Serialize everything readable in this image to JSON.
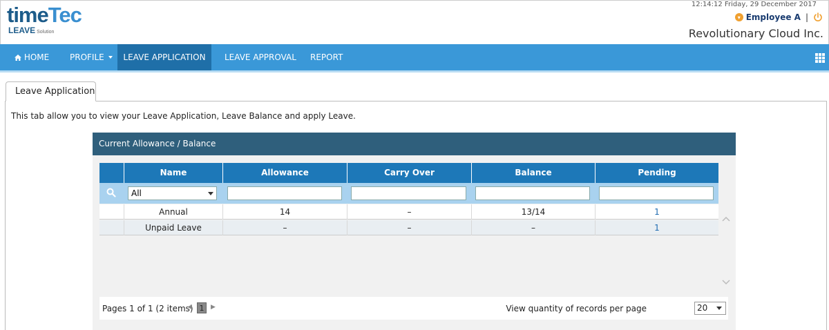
{
  "header": {
    "logo_top": "time",
    "logo_top_accent": "Tec",
    "logo_sub": "LEAVE",
    "logo_sub_small": "Solution",
    "datetime": "12:14:12 Friday, 29 December 2017",
    "user_name": "Employee A",
    "separator": "|",
    "company": "Revolutionary Cloud Inc."
  },
  "nav": {
    "home": "HOME",
    "profile": "PROFILE",
    "leave_application": "LEAVE APPLICATION",
    "leave_approval": "LEAVE APPROVAL",
    "report": "REPORT",
    "active": "leave_application",
    "home_icon": "home-icon",
    "apps_icon": "apps-grid-icon"
  },
  "tab": {
    "label": "Leave Application"
  },
  "description": "This tab allow you to view your Leave Application, Leave Balance and apply Leave.",
  "widget": {
    "title": "Current Allowance / Balance",
    "columns": [
      "Name",
      "Allowance",
      "Carry Over",
      "Balance",
      "Pending"
    ],
    "filter": {
      "name_selected": "All"
    },
    "rows": [
      {
        "name": "Annual",
        "allowance": "14",
        "carry_over": "–",
        "balance": "13/14",
        "pending": "1"
      },
      {
        "name": "Unpaid Leave",
        "allowance": "–",
        "carry_over": "–",
        "balance": "–",
        "pending": "1"
      }
    ],
    "pager": {
      "info": "Pages 1 of 1 (2 items)",
      "current_page": "1",
      "per_page_label": "View quantity of records per page",
      "per_page_value": "20"
    }
  },
  "colors": {
    "nav_bg": "#3a98d8",
    "nav_active": "#1f6fa8",
    "widget_head": "#2f5f7c",
    "grid_head": "#1d78b8",
    "filter_row": "#a9d2ef",
    "user_name": "#1a3c70"
  }
}
